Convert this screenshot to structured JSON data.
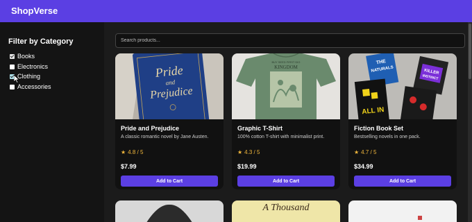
{
  "header": {
    "brand": "ShopVerse"
  },
  "sidebar": {
    "title": "Filter by Category",
    "categories": [
      {
        "label": "Books",
        "checked": true
      },
      {
        "label": "Electronics",
        "checked": false
      },
      {
        "label": "Clothing",
        "checked": true
      },
      {
        "label": "Accessories",
        "checked": false
      }
    ]
  },
  "search": {
    "placeholder": "Search products..."
  },
  "products": [
    {
      "title": "Pride and Prejudice",
      "desc": "A classic romantic novel by Jane Austen.",
      "rating": "4.8 / 5",
      "price": "$7.99",
      "button": "Add to Cart",
      "image_text": "Pride and Prejudice"
    },
    {
      "title": "Graphic T-Shirt",
      "desc": "100% cotton T-shirt with minimalist print.",
      "rating": "4.3 / 5",
      "price": "$19.99",
      "button": "Add to Cart",
      "image_text": "KINGDOM"
    },
    {
      "title": "Fiction Book Set",
      "desc": "Bestselling novels in one pack.",
      "rating": "4.7 / 5",
      "price": "$34.99",
      "button": "Add to Cart",
      "image_text": "ALL IN"
    }
  ],
  "second_row": [
    {
      "image_text": ""
    },
    {
      "image_text": "A Thousand"
    },
    {
      "image_text": ""
    }
  ],
  "colors": {
    "accent": "#5b3fe3",
    "star": "#f1b73c"
  }
}
